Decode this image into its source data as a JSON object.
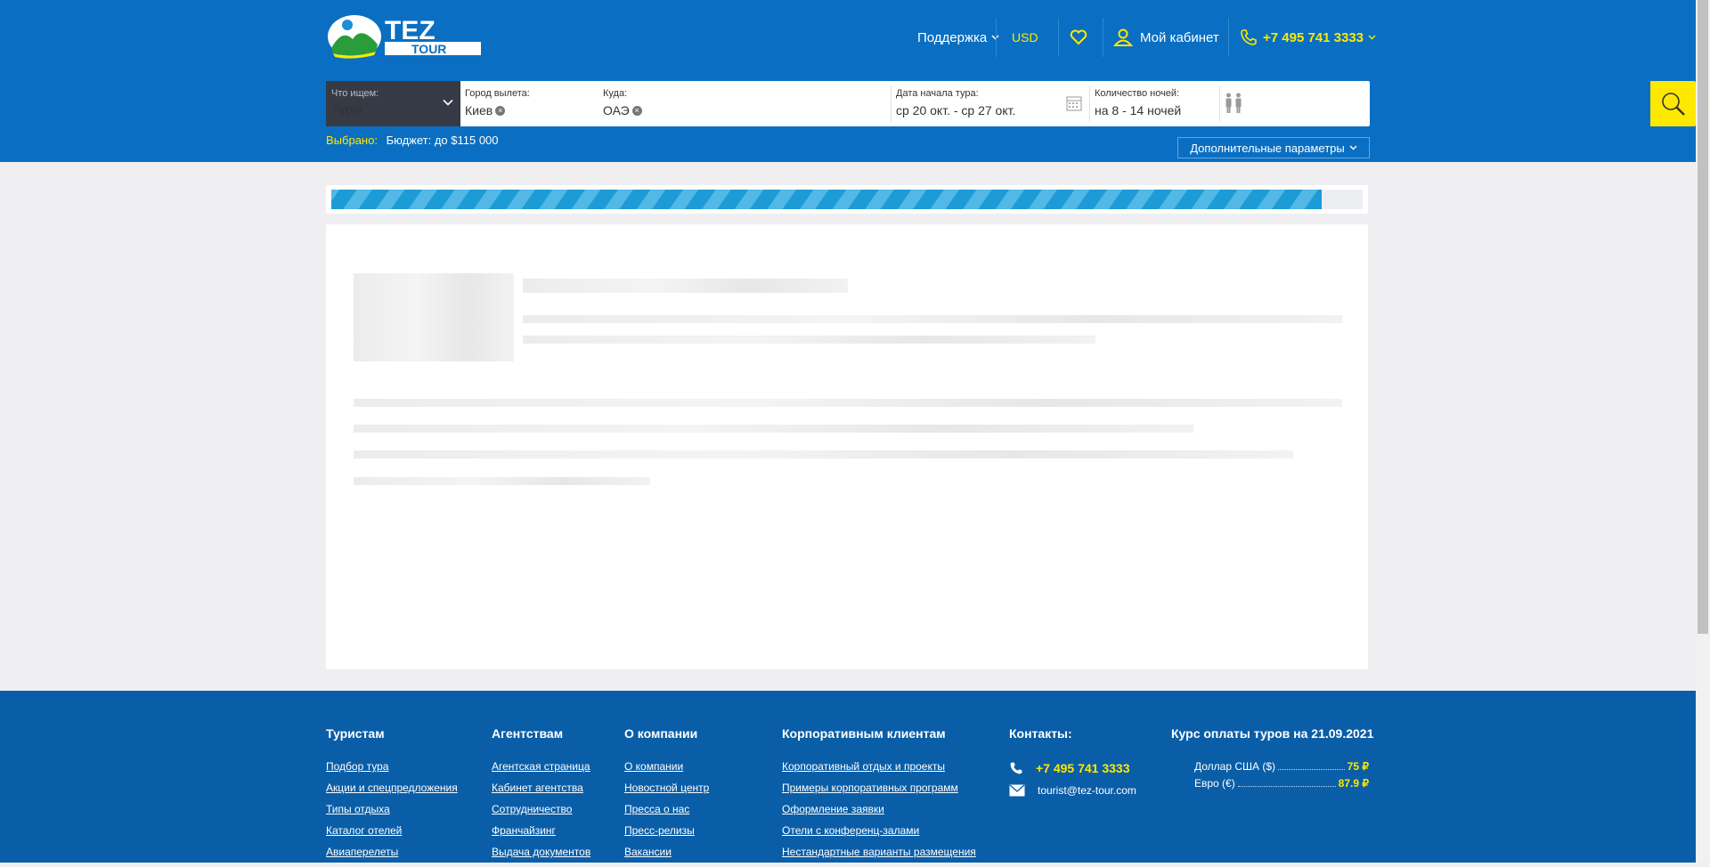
{
  "header": {
    "logo_text_top": "TEZ",
    "logo_text_bottom": "TOUR",
    "support": "Поддержка",
    "currency": "USD",
    "cabinet": "Мой кабинет",
    "phone": "+7 495 741 3333"
  },
  "search": {
    "type_label": "Что ищем:",
    "type_value": "Туры",
    "from_label": "Город вылета:",
    "from_value": "Киев",
    "to_label": "Куда:",
    "to_value": "ОАЭ",
    "date_label": "Дата начала тура:",
    "date_value": "ср 20 окт. - ср 27 окт.",
    "nights_label": "Количество ночей:",
    "nights_value": "на 8 - 14 ночей",
    "selected_label": "Выбрано:",
    "selected_value": "Бюджет: до $115 000",
    "extra_params": "Дополнительные параметры"
  },
  "loading": {
    "progress_fraction": 0.96
  },
  "footer": {
    "tourists": {
      "title": "Туристам",
      "links": [
        "Подбор тура",
        "Акции и спецпредложения",
        "Типы отдыха",
        "Каталог отелей",
        "Авиаперелеты"
      ]
    },
    "agencies": {
      "title": "Агентствам",
      "links": [
        "Агентская страница",
        "Кабинет агентства",
        "Сотрудничество",
        "Франчайзинг",
        "Выдача документов"
      ]
    },
    "company": {
      "title": "О компании",
      "links": [
        "О компании",
        "Новостной центр",
        "Пресса о нас",
        "Пресс-релизы",
        "Вакансии"
      ]
    },
    "corporate": {
      "title": "Корпоративным клиентам",
      "links": [
        "Корпоративный отдых и проекты",
        "Примеры корпоративных программ",
        "Оформление заявки",
        "Отели с конференц-залами",
        "Нестандартные варианты размещения"
      ]
    },
    "contacts": {
      "title": "Контакты:",
      "phone": "+7 495 741 3333",
      "email": "tourist@tez-tour.com"
    },
    "rates": {
      "title": "Курс оплаты туров на 21.09.2021",
      "items": [
        {
          "label": "Доллар США ($)",
          "value": "75 ₽"
        },
        {
          "label": "Евро (€)",
          "value": "87.9 ₽"
        }
      ]
    }
  },
  "colors": {
    "header_blue": "#0a6fc2",
    "footer_blue": "#0a5ea8",
    "accent_yellow": "#ffe800"
  }
}
